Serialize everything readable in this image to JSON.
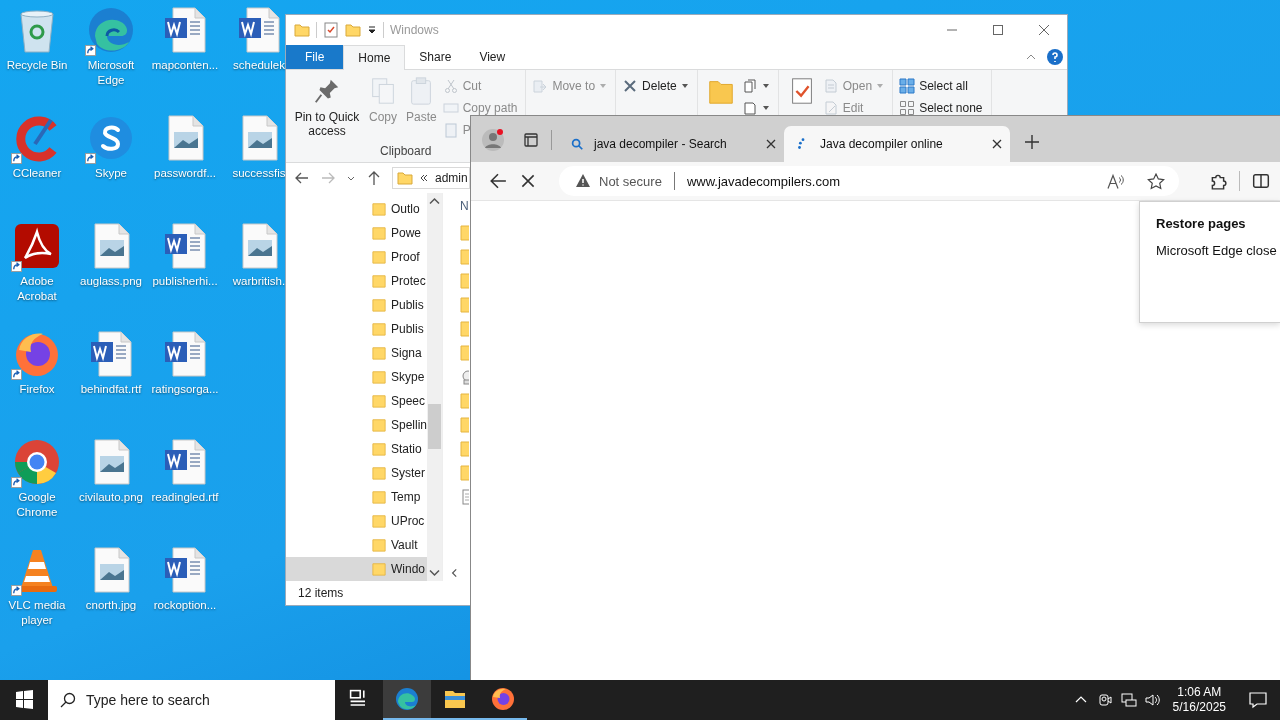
{
  "desktop": {
    "icons": [
      {
        "label": "Recycle Bin",
        "kind": "recycle",
        "shortcut": false
      },
      {
        "label": "CCleaner",
        "kind": "ccleaner",
        "shortcut": true
      },
      {
        "label": "Adobe Acrobat",
        "kind": "acrobat",
        "shortcut": true
      },
      {
        "label": "Firefox",
        "kind": "firefox",
        "shortcut": true
      },
      {
        "label": "Google Chrome",
        "kind": "chrome",
        "shortcut": true
      },
      {
        "label": "VLC media player",
        "kind": "vlc",
        "shortcut": true
      },
      {
        "label": "Microsoft Edge",
        "kind": "edge",
        "shortcut": true
      },
      {
        "label": "Skype",
        "kind": "skype",
        "shortcut": true
      },
      {
        "label": "auglass.png",
        "kind": "image",
        "shortcut": false
      },
      {
        "label": "behindfat.rtf",
        "kind": "word",
        "shortcut": false
      },
      {
        "label": "civilauto.png",
        "kind": "image",
        "shortcut": false
      },
      {
        "label": "cnorth.jpg",
        "kind": "image",
        "shortcut": false
      },
      {
        "label": "mapconten...",
        "kind": "word",
        "shortcut": false
      },
      {
        "label": "passwordf...",
        "kind": "image",
        "shortcut": false
      },
      {
        "label": "publisherhi...",
        "kind": "word",
        "shortcut": false
      },
      {
        "label": "ratingsorga...",
        "kind": "word",
        "shortcut": false
      },
      {
        "label": "readingled.rtf",
        "kind": "word",
        "shortcut": false
      },
      {
        "label": "rockoption...",
        "kind": "word",
        "shortcut": false
      },
      {
        "label": "schedulek",
        "kind": "word",
        "shortcut": false
      },
      {
        "label": "successfis",
        "kind": "image",
        "shortcut": false
      },
      {
        "label": "warbritish.",
        "kind": "image",
        "shortcut": false
      }
    ]
  },
  "explorer": {
    "title": "Windows",
    "ribbon_tabs": [
      {
        "label": "File",
        "kind": "file",
        "selected": false
      },
      {
        "label": "Home",
        "kind": "tab",
        "selected": true
      },
      {
        "label": "Share",
        "kind": "tab",
        "selected": false
      },
      {
        "label": "View",
        "kind": "tab",
        "selected": false
      }
    ],
    "ribbon_groups": [
      {
        "label": "Clipboard",
        "large": [
          {
            "label": "Pin to Quick access",
            "kind": "pin",
            "disabled": false
          },
          {
            "label": "Copy",
            "kind": "copy",
            "disabled": true
          },
          {
            "label": "Paste",
            "kind": "paste",
            "disabled": true
          }
        ],
        "small": [
          {
            "label": "Cut",
            "kind": "cut",
            "disabled": true,
            "dropdown": false
          },
          {
            "label": "Copy path",
            "kind": "copypath",
            "disabled": true,
            "dropdown": false
          },
          {
            "label": "P",
            "kind": "pasteshortcut",
            "disabled": true,
            "dropdown": false
          }
        ]
      },
      {
        "small": [
          {
            "label": "Move to",
            "kind": "moveto",
            "disabled": true,
            "dropdown": true
          }
        ]
      },
      {
        "small": [
          {
            "label": "Delete",
            "kind": "delete",
            "disabled": false,
            "dropdown": true
          }
        ]
      },
      {
        "large": [
          {
            "kind": "newfolder",
            "disabled": false
          }
        ],
        "small": [
          {
            "kind": "newitem",
            "disabled": false,
            "dropdown": true
          },
          {
            "kind": "easyaccess",
            "disabled": false,
            "dropdown": true
          }
        ]
      },
      {
        "large": [
          {
            "kind": "properties",
            "disabled": false
          }
        ],
        "small": [
          {
            "label": "Open",
            "kind": "open",
            "disabled": true,
            "dropdown": true
          },
          {
            "label": "Edit",
            "kind": "edit",
            "disabled": true,
            "dropdown": false
          }
        ]
      },
      {
        "small": [
          {
            "label": "Select all",
            "kind": "selectall",
            "disabled": false,
            "dropdown": false
          },
          {
            "label": "Select none",
            "kind": "selectnone",
            "disabled": false,
            "dropdown": false
          }
        ]
      }
    ],
    "address": "admin",
    "nav_items": [
      {
        "label": "Outlo",
        "selected": false
      },
      {
        "label": "Powe",
        "selected": false
      },
      {
        "label": "Proof",
        "selected": false
      },
      {
        "label": "Protec",
        "selected": false
      },
      {
        "label": "Publis",
        "selected": false
      },
      {
        "label": "Publis",
        "selected": false
      },
      {
        "label": "Signa",
        "selected": false
      },
      {
        "label": "Skype",
        "selected": false
      },
      {
        "label": "Speec",
        "selected": false
      },
      {
        "label": "Spellin",
        "selected": false
      },
      {
        "label": "Statio",
        "selected": false
      },
      {
        "label": "Syster",
        "selected": false
      },
      {
        "label": "Temp",
        "selected": false
      },
      {
        "label": "UProc",
        "selected": false
      },
      {
        "label": "Vault",
        "selected": false
      },
      {
        "label": "Windo",
        "selected": true
      }
    ],
    "content_header": "N",
    "content_items": [
      {
        "kind": "folder"
      },
      {
        "kind": "folder"
      },
      {
        "kind": "folder"
      },
      {
        "kind": "folder"
      },
      {
        "kind": "folder"
      },
      {
        "kind": "folder"
      },
      {
        "kind": "special"
      },
      {
        "kind": "folder"
      },
      {
        "kind": "folder"
      },
      {
        "kind": "folder"
      },
      {
        "kind": "folder"
      },
      {
        "kind": "file"
      }
    ],
    "status": "12 items"
  },
  "browser": {
    "tabs": [
      {
        "title": "java decompiler - Search",
        "kind": "search",
        "selected": false
      },
      {
        "title": "Java decompiler online",
        "kind": "loading",
        "selected": true
      }
    ],
    "security": "Not secure",
    "url": "www.javadecompilers.com",
    "popup": {
      "title": "Restore pages",
      "text": "Microsoft Edge close"
    }
  },
  "taskbar": {
    "search_placeholder": "Type here to search",
    "apps": [
      {
        "kind": "taskview",
        "running": false,
        "active": false
      },
      {
        "kind": "edge",
        "running": true,
        "active": true
      },
      {
        "kind": "explorer",
        "running": true,
        "active": false
      },
      {
        "kind": "firefox",
        "running": true,
        "active": false
      }
    ],
    "time": "1:06 AM",
    "date": "5/16/2025"
  }
}
